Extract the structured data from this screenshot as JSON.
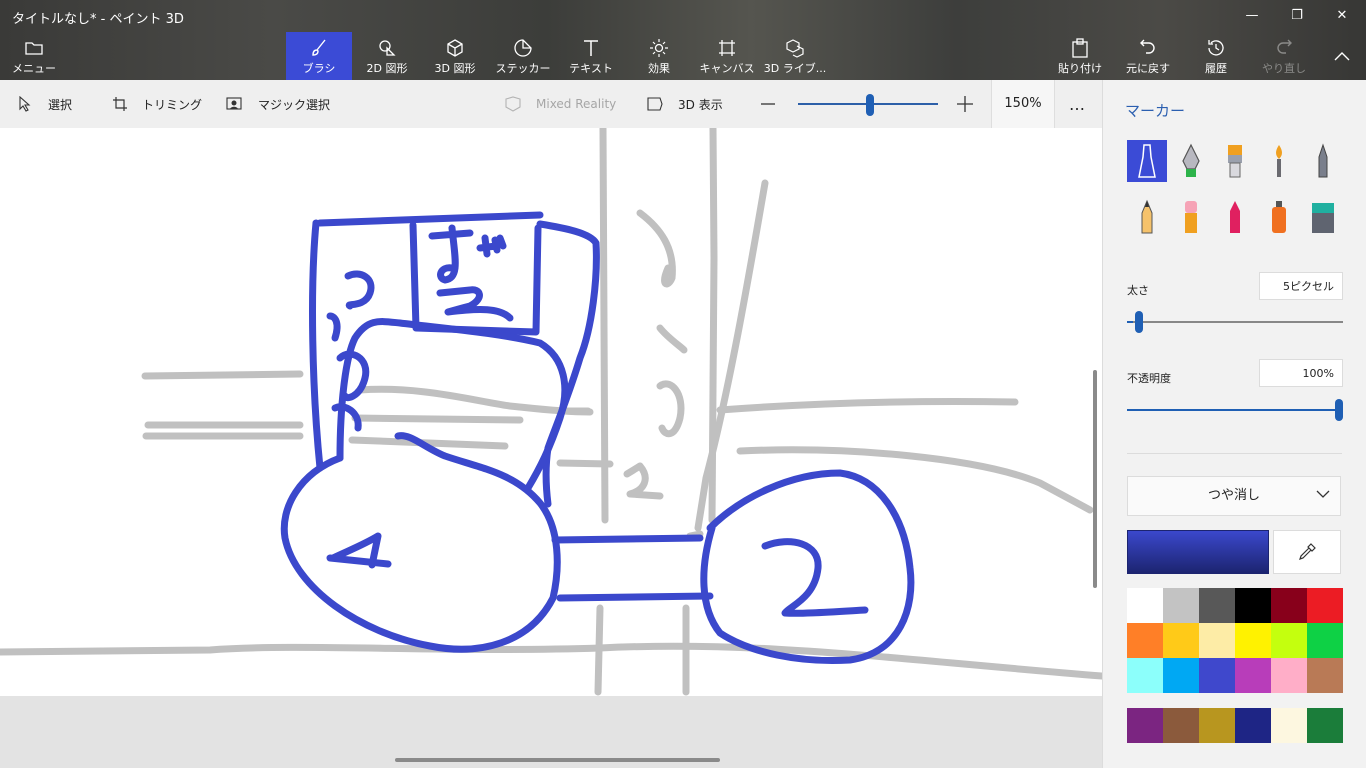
{
  "window": {
    "title": "タイトルなし* - ペイント 3D",
    "controls": [
      "—",
      "❐",
      "✕"
    ]
  },
  "ribbon": {
    "menu_label": "メニュー",
    "tools": [
      {
        "label": "ブラシ",
        "icon": "brush-icon",
        "active": true
      },
      {
        "label": "2D 図形",
        "icon": "2d-shapes-icon"
      },
      {
        "label": "3D 図形",
        "icon": "3d-shapes-icon"
      },
      {
        "label": "ステッカー",
        "icon": "sticker-icon"
      },
      {
        "label": "テキスト",
        "icon": "text-icon"
      },
      {
        "label": "効果",
        "icon": "effects-icon"
      },
      {
        "label": "キャンバス",
        "icon": "canvas-icon"
      },
      {
        "label": "3D ライブ...",
        "icon": "3d-library-icon"
      }
    ],
    "right": [
      {
        "label": "貼り付け",
        "icon": "paste-icon"
      },
      {
        "label": "元に戻す",
        "icon": "undo-icon"
      },
      {
        "label": "履歴",
        "icon": "history-icon"
      },
      {
        "label": "やり直し",
        "icon": "redo-icon",
        "disabled": true
      }
    ]
  },
  "toolbar": {
    "select": "選択",
    "crop": "トリミング",
    "magic_select": "マジック選択",
    "mixed_reality": "Mixed Reality",
    "view3d": "3D 表示",
    "zoom_value": "150%",
    "zoom_level": 0.52,
    "more": "…"
  },
  "panel": {
    "title": "マーカー",
    "brushes": [
      "marker-icon",
      "calligraphy-pen-icon",
      "oil-brush-icon",
      "watercolor-icon",
      "pixel-pen-icon",
      "pencil-icon",
      "eraser-icon",
      "crayon-icon",
      "spray-can-icon",
      "fill-bucket-icon"
    ],
    "thickness_label": "太さ",
    "thickness_value": "5ピクセル",
    "thickness_level": 0.02,
    "opacity_label": "不透明度",
    "opacity_value": "100%",
    "opacity_level": 1.0,
    "finish_value": "つや消し",
    "current_color": "#3b48cc",
    "palette": [
      "#ffffff",
      "#c3c3c3",
      "#585858",
      "#000000",
      "#88001b",
      "#ec1c24",
      "#ff7f27",
      "#ffca18",
      "#fdeca6",
      "#fff200",
      "#c4ff0e",
      "#0ed145",
      "#8cfffb",
      "#00a8f3",
      "#3f48cc",
      "#b83dba",
      "#ffaec8",
      "#b97a56"
    ],
    "custom_colors": [
      "#7b2581",
      "#8b5a3c",
      "#b8961f",
      "#1e2585",
      "#fdf7e0",
      "#1b7d3a"
    ]
  }
}
